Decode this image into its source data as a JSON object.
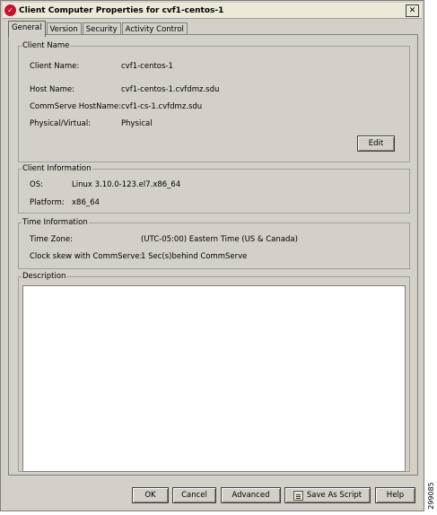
{
  "window": {
    "title": "Client Computer Properties for cvf1-centos-1",
    "close_symbol": "✕"
  },
  "tabs": [
    "General",
    "Version",
    "Security",
    "Activity Control"
  ],
  "client_name": {
    "title": "Client Name",
    "client_name_label": "Client Name:",
    "client_name_value": "cvf1-centos-1",
    "host_name_label": "Host Name:",
    "host_name_value": "cvf1-centos-1.cvfdmz.sdu",
    "commserve_label": "CommServe HostName:",
    "commserve_value": "cvf1-cs-1.cvfdmz.sdu",
    "physical_label": "Physical/Virtual:",
    "physical_value": "Physical",
    "edit_label": "Edit"
  },
  "client_info": {
    "title": "Client Information",
    "os_label": "OS:",
    "os_value": "Linux 3.10.0-123.el7.x86_64",
    "platform_label": "Platform:",
    "platform_value": "x86_64"
  },
  "time_info": {
    "title": "Time Information",
    "zone_label": "Time Zone:",
    "zone_value": "(UTC-05:00) Eastern Time (US & Canada)",
    "skew_label": "Clock skew with CommServe:",
    "skew_value": "1 Sec(s)behind CommServe"
  },
  "description": {
    "title": "Description",
    "text": ""
  },
  "buttons": {
    "ok": "OK",
    "cancel": "Cancel",
    "advanced": "Advanced",
    "save_script": "Save As Script",
    "help": "Help"
  },
  "figure_number": "299085",
  "icons": {
    "app": "commvault-logo-icon",
    "close": "close-icon",
    "script": "script-icon"
  },
  "colors": {
    "dialog_bg": "#d4d0c8",
    "app_icon": "#c8102e"
  }
}
